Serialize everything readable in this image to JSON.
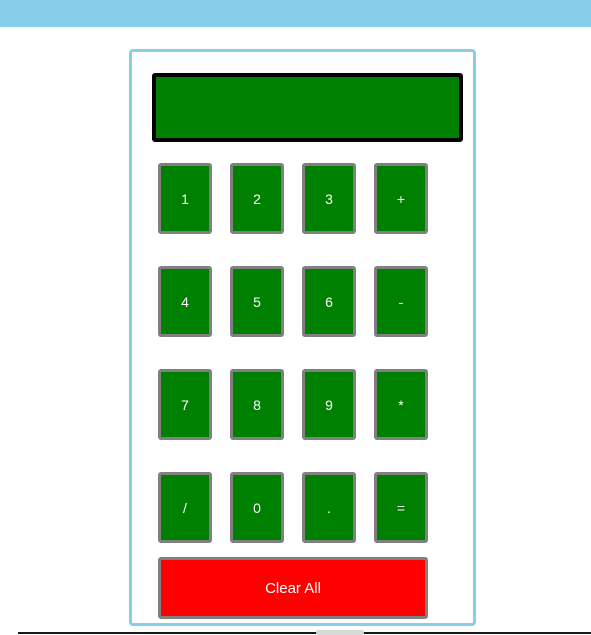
{
  "header": {
    "title": ""
  },
  "calculator": {
    "display_value": "",
    "keys": [
      {
        "label": "1",
        "name": "key-1"
      },
      {
        "label": "2",
        "name": "key-2"
      },
      {
        "label": "3",
        "name": "key-3"
      },
      {
        "label": "+",
        "name": "key-plus"
      },
      {
        "label": "4",
        "name": "key-4"
      },
      {
        "label": "5",
        "name": "key-5"
      },
      {
        "label": "6",
        "name": "key-6"
      },
      {
        "label": "-",
        "name": "key-minus"
      },
      {
        "label": "7",
        "name": "key-7"
      },
      {
        "label": "8",
        "name": "key-8"
      },
      {
        "label": "9",
        "name": "key-9"
      },
      {
        "label": "*",
        "name": "key-multiply"
      },
      {
        "label": "/",
        "name": "key-divide"
      },
      {
        "label": "0",
        "name": "key-0"
      },
      {
        "label": ".",
        "name": "key-decimal"
      },
      {
        "label": "=",
        "name": "key-equals"
      }
    ],
    "clear_label": "Clear All"
  },
  "colors": {
    "banner": "#87ceeb",
    "display_bg": "#008000",
    "key_bg": "#008000",
    "clear_bg": "#ff0000",
    "frame_border": "#87ceeb"
  }
}
